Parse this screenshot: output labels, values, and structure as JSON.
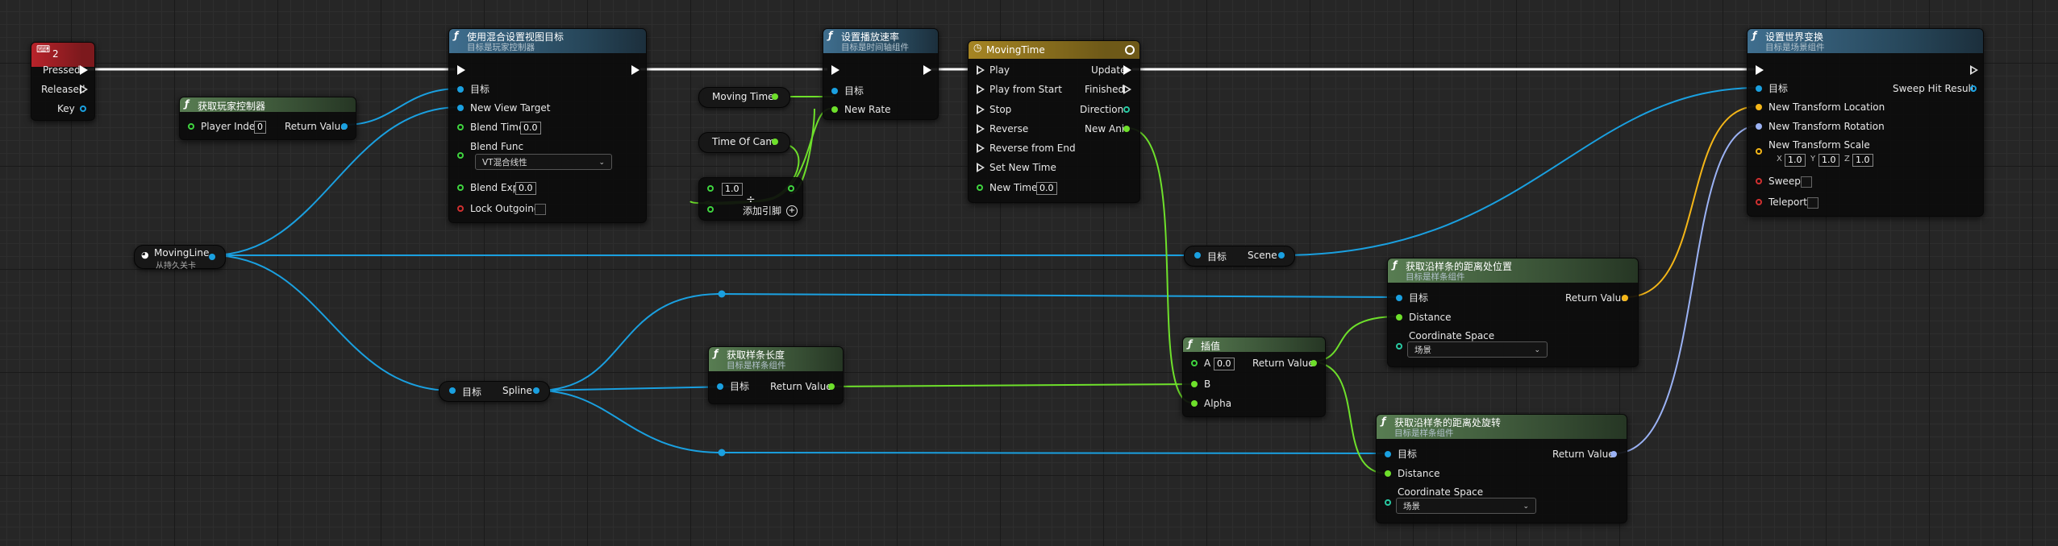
{
  "colors": {
    "exec": "#ffffff",
    "object": "#1aa0e0",
    "float": "#6ee02b",
    "vector": "#f4b618",
    "rotator": "#9bb2f4",
    "bool": "#d03030"
  },
  "event_node": {
    "key": "2",
    "pins": [
      "Pressed",
      "Released",
      "Key"
    ]
  },
  "get_player_controller": {
    "title": "获取玩家控制器",
    "player_index_label": "Player Index",
    "player_index_value": "0",
    "return_label": "Return Value"
  },
  "set_view_target": {
    "title": "使用混合设置视图目标",
    "subtitle": "目标是玩家控制器",
    "target": "目标",
    "new_view_target": "New View Target",
    "blend_time": "Blend Time",
    "blend_time_value": "0.0",
    "blend_func": "Blend Func",
    "blend_func_value": "VT混合线性",
    "blend_exp": "Blend Exp",
    "blend_exp_value": "0.0",
    "lock_outgoing": "Lock Outgoing"
  },
  "moving_time_var": {
    "label": "Moving Time"
  },
  "time_of_cam_var": {
    "label": "Time Of Cam"
  },
  "divide_node": {
    "value": "1.0",
    "symbol": "÷",
    "add_pin": "添加引脚"
  },
  "set_play_rate": {
    "title": "设置播放速率",
    "subtitle": "目标是时间轴组件",
    "target": "目标",
    "new_rate": "New Rate"
  },
  "timeline": {
    "title": "MovingTime",
    "inputs": [
      "Play",
      "Play from Start",
      "Stop",
      "Reverse",
      "Reverse from End",
      "Set New Time",
      "New Time"
    ],
    "new_time_value": "0.0",
    "outputs": [
      "Update",
      "Finished",
      "Direction",
      "New Ani"
    ]
  },
  "set_world_transform": {
    "title": "设置世界变换",
    "subtitle": "目标是场景组件",
    "target": "目标",
    "sweep_hit_result": "Sweep Hit Result",
    "new_location": "New Transform Location",
    "new_rotation": "New Transform Rotation",
    "new_scale": "New Transform Scale",
    "scale_x": "1.0",
    "scale_y": "1.0",
    "scale_z": "1.0",
    "x_label": "X",
    "y_label": "Y",
    "z_label": "Z",
    "sweep": "Sweep",
    "teleport": "Teleport"
  },
  "moving_line_var": {
    "label": "MovingLine",
    "subtitle": "从持久关卡"
  },
  "scene_get": {
    "target": "目标",
    "output": "Scene"
  },
  "spline_get": {
    "target": "目标",
    "output": "Spline"
  },
  "get_spline_length": {
    "title": "获取样条长度",
    "subtitle": "目标是样条组件",
    "target": "目标",
    "return_label": "Return Value"
  },
  "lerp": {
    "title": "插值",
    "a": "A",
    "a_value": "0.0",
    "b": "B",
    "alpha": "Alpha",
    "return_label": "Return Value"
  },
  "get_location": {
    "title": "获取沿样条的距离处位置",
    "subtitle": "目标是样条组件",
    "target": "目标",
    "distance": "Distance",
    "coord_space": "Coordinate Space",
    "coord_value": "场景",
    "return_label": "Return Value"
  },
  "get_rotation": {
    "title": "获取沿样条的距离处旋转",
    "subtitle": "目标是样条组件",
    "target": "目标",
    "distance": "Distance",
    "coord_space": "Coordinate Space",
    "coord_value": "场景",
    "return_label": "Return Value"
  }
}
